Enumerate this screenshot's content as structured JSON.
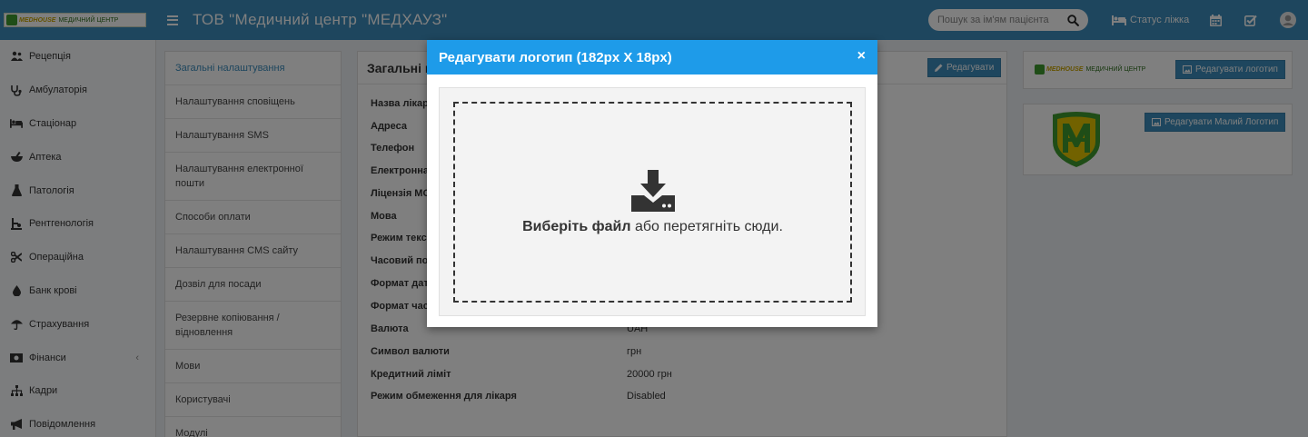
{
  "topbar": {
    "logo_brand": "MEDHOUSE",
    "logo_text": "МЕДИЧНИЙ ЦЕНТР",
    "title": "ТОВ \"Медичний центр \"МЕДХАУЗ\"",
    "search_placeholder": "Пошук за ім'ям пацієнта",
    "bed_status_label": "Статус ліжка"
  },
  "sidebar": {
    "items": [
      {
        "label": "Рецепція",
        "icon": "people-icon"
      },
      {
        "label": "Амбулаторія",
        "icon": "stethoscope-icon"
      },
      {
        "label": "Стаціонар",
        "icon": "bed-icon"
      },
      {
        "label": "Аптека",
        "icon": "mortar-pestle-icon"
      },
      {
        "label": "Патологія",
        "icon": "flask-icon"
      },
      {
        "label": "Рентгенологія",
        "icon": "xray-icon"
      },
      {
        "label": "Операційна",
        "icon": "scissors-icon"
      },
      {
        "label": "Банк крові",
        "icon": "blood-drop-icon"
      },
      {
        "label": "Страхування",
        "icon": "umbrella-icon"
      },
      {
        "label": "Фінанси",
        "icon": "money-icon"
      },
      {
        "label": "Кадри",
        "icon": "sitemap-icon"
      },
      {
        "label": "Повідомлення",
        "icon": "bullhorn-icon"
      }
    ]
  },
  "settings_menu": {
    "items": [
      "Загальні налаштування",
      "Налаштування сповіщень",
      "Налаштування SMS",
      "Налаштування електронної пошти",
      "Способи оплати",
      "Налаштування CMS сайту",
      "Дозвіл для посади",
      "Резервне копіювання / відновлення",
      "Мови",
      "Користувачі",
      "Модулі"
    ]
  },
  "main": {
    "title": "Загальні н",
    "edit_label": "Редагувати",
    "rows": [
      {
        "key": "Назва лікар",
        "value": ""
      },
      {
        "key": "Адреса",
        "value": ""
      },
      {
        "key": "Телефон",
        "value": ""
      },
      {
        "key": "Електронна",
        "value": ""
      },
      {
        "key": "Ліцензія МО",
        "value": ""
      },
      {
        "key": "Мова",
        "value": ""
      },
      {
        "key": "Режим текст",
        "value": ""
      },
      {
        "key": "Часовий пол",
        "value": ""
      },
      {
        "key": "Формат дат",
        "value": ""
      },
      {
        "key": "Формат час",
        "value": ""
      },
      {
        "key": "Валюта",
        "value": "UAH"
      },
      {
        "key": "Символ валюти",
        "value": "грн"
      },
      {
        "key": "Кредитний ліміт",
        "value": "20000 грн"
      },
      {
        "key": "Режим обмеження для лікаря",
        "value": "Disabled"
      }
    ]
  },
  "right": {
    "logo_brand": "MEDHOUSE",
    "logo_text": "МЕДИЧНИЙ ЦЕНТР",
    "edit_logo_label": "Редагувати логотип",
    "edit_small_logo_label": "Редагувати Малий Логотип"
  },
  "modal": {
    "title": "Редагувати логотип (182px X 18px)",
    "close": "×",
    "dropzone_bold": "Виберіть файл",
    "dropzone_rest": " або перетягніть сюди."
  },
  "colors": {
    "topbar": "#3c8dbc",
    "modal_header": "#1e9be9",
    "button": "#3c8dbc"
  }
}
